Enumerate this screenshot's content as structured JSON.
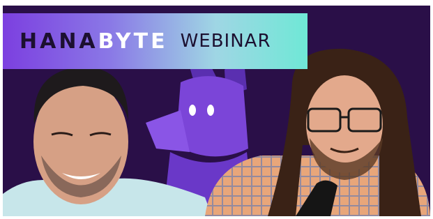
{
  "banner": {
    "brand_part1": "HANA",
    "brand_part2": "BYTE",
    "subtitle": "WEBINAR"
  },
  "colors": {
    "background": "#2a0f48",
    "banner_start": "#7c3fe0",
    "banner_end": "#6fe8d6",
    "mascot": "#7b45d8",
    "left_shirt": "#c7e6ea",
    "right_shirt": "#e8a67a"
  },
  "icons": {
    "mascot": "purple-fox-mascot-icon",
    "microphone": "microphone-icon"
  }
}
